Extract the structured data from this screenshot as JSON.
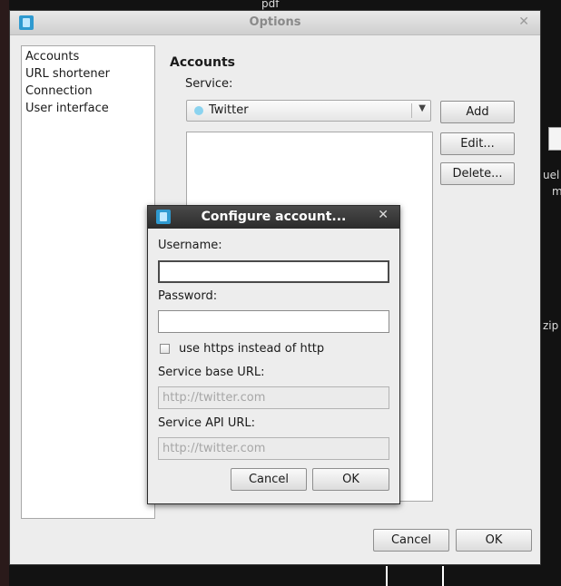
{
  "desktop": {
    "top_text": "pdf",
    "right_texts": [
      "uel",
      "m",
      "zip"
    ]
  },
  "options": {
    "title": "Options",
    "nav": [
      "Accounts",
      "URL shortener",
      "Connection",
      "User interface"
    ],
    "section_title": "Accounts",
    "service_label": "Service:",
    "service_value": "Twitter",
    "buttons": {
      "add": "Add",
      "edit": "Edit...",
      "delete": "Delete...",
      "cancel": "Cancel",
      "ok": "OK"
    }
  },
  "configure": {
    "title": "Configure account...",
    "username_label": "Username:",
    "username_value": "",
    "password_label": "Password:",
    "password_value": "",
    "https_label": "use https instead of http",
    "https_checked": false,
    "base_url_label": "Service base URL:",
    "base_url_placeholder": "http://twitter.com",
    "api_url_label": "Service API URL:",
    "api_url_placeholder": "http://twitter.com",
    "cancel": "Cancel",
    "ok": "OK"
  },
  "icons": [
    "app-icon",
    "close-icon",
    "twitter-bird-icon",
    "dropdown-arrow-icon"
  ]
}
